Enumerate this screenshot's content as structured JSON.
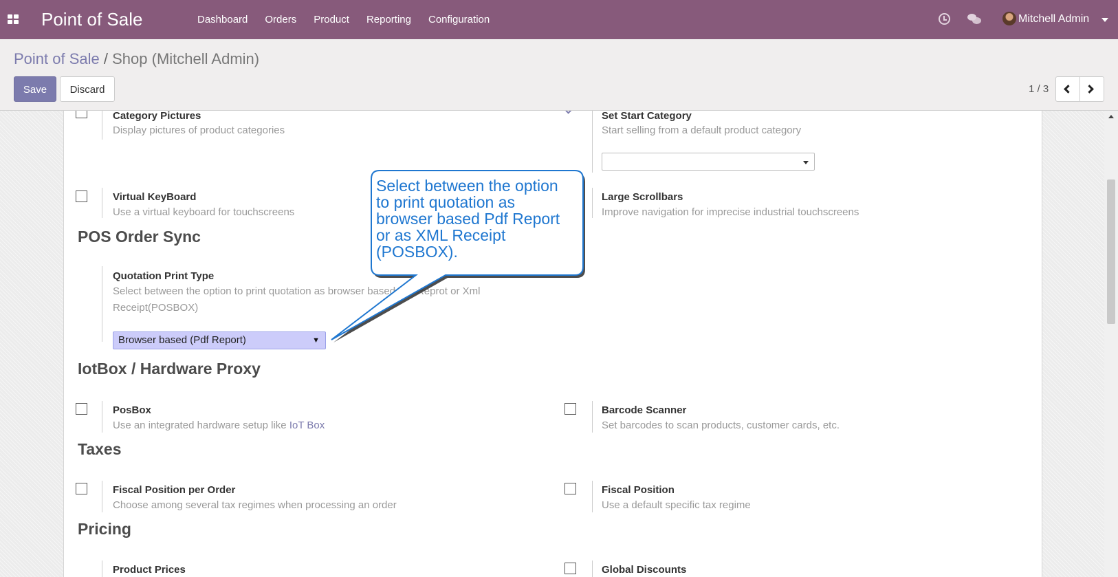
{
  "navbar": {
    "app_title": "Point of Sale",
    "menu": [
      "Dashboard",
      "Orders",
      "Product",
      "Reporting",
      "Configuration"
    ],
    "user_name": "Mitchell Admin",
    "icons": [
      "apps-icon",
      "clock-icon",
      "chat-icon",
      "avatar",
      "caret-down-icon"
    ]
  },
  "control_panel": {
    "breadcrumb_root": "Point of Sale",
    "breadcrumb_separator": "/",
    "breadcrumb_current": "Shop (Mitchell Admin)",
    "save_label": "Save",
    "discard_label": "Discard",
    "pager": "1 / 3"
  },
  "settings": {
    "category_pictures": {
      "title": "Category Pictures",
      "desc": "Display pictures of product categories",
      "checked": false
    },
    "set_start_category": {
      "title": "Set Start Category",
      "desc": "Start selling from a default product category",
      "checked": true,
      "value": ""
    },
    "virtual_keyboard": {
      "title": "Virtual KeyBoard",
      "desc": "Use a virtual keyboard for touchscreens",
      "checked": false
    },
    "large_scrollbars": {
      "title": "Large Scrollbars",
      "desc": "Improve navigation for imprecise industrial touchscreens"
    },
    "pos_order_sync": {
      "heading": "POS Order Sync"
    },
    "quotation_print_type": {
      "title": "Quotation Print Type",
      "desc": "Select between the option to print quotation as browser based Pdf Reprot or Xml Receipt(POSBOX)",
      "selected": "Browser based (Pdf Report)"
    },
    "iotbox": {
      "heading": "IotBox / Hardware Proxy"
    },
    "posbox": {
      "title": "PosBox",
      "desc_prefix": "Use an integrated hardware setup like",
      "desc_link": "IoT Box",
      "checked": false
    },
    "barcode_scanner": {
      "title": "Barcode Scanner",
      "desc": "Set barcodes to scan products, customer cards, etc.",
      "checked": false
    },
    "taxes": {
      "heading": "Taxes"
    },
    "fiscal_position_per_order": {
      "title": "Fiscal Position per Order",
      "desc": "Choose among several tax regimes when processing an order",
      "checked": false
    },
    "fiscal_position": {
      "title": "Fiscal Position",
      "desc": "Use a default specific tax regime",
      "checked": false
    },
    "pricing": {
      "heading": "Pricing"
    },
    "product_prices": {
      "title": "Product Prices"
    },
    "global_discounts": {
      "title": "Global Discounts",
      "checked": false
    }
  },
  "callout": {
    "text": "Select between the option to print quotation as browser based Pdf Report or as XML Receipt (POSBOX)."
  }
}
